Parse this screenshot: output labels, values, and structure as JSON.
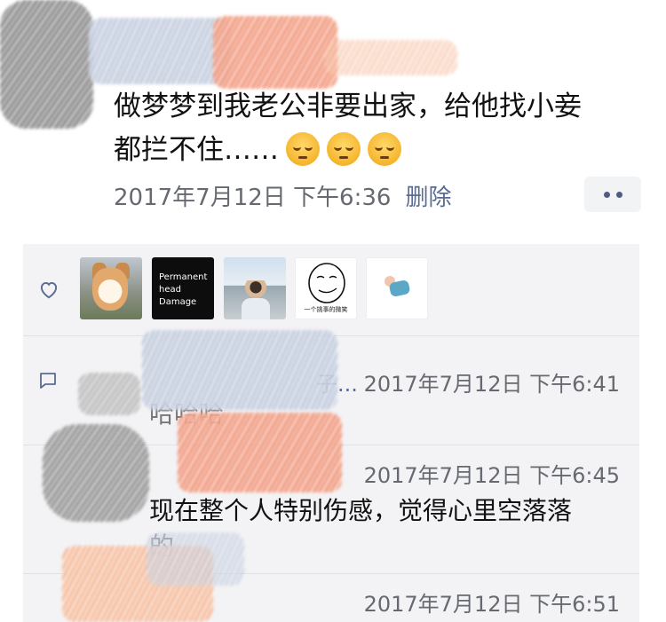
{
  "post": {
    "text_line1": "做梦梦到我老公非要出家，给他找小妾",
    "text_line2": "都拦不住……",
    "emojis": [
      "pensive-emoji",
      "pensive-emoji",
      "pensive-emoji"
    ],
    "timestamp": "2017年7月12日 下午6:36",
    "delete_label": "删除"
  },
  "likes": {
    "avatars": [
      {
        "type": "dog-photo"
      },
      {
        "type": "text-avatar",
        "lines": [
          "Permanent",
          "head",
          "Damage"
        ]
      },
      {
        "type": "person-photo"
      },
      {
        "type": "meme-face",
        "caption": "一个挑事的微笑"
      },
      {
        "type": "cartoon"
      }
    ]
  },
  "comments": [
    {
      "name_tail": "子...",
      "time": "2017年7月12日 下午6:41",
      "text": "哈哈哈"
    },
    {
      "name_tail": "",
      "time": "2017年7月12日 下午6:45",
      "text_line1": "现在整个人特别伤感，觉得心里空落落",
      "text_line2": "的"
    },
    {
      "name_tail": "",
      "time": "2017年7月12日 下午6:51",
      "text": ""
    }
  ],
  "colors": {
    "link": "#5b6b93",
    "meta": "#666a70",
    "panel_bg": "#f3f3f5"
  }
}
